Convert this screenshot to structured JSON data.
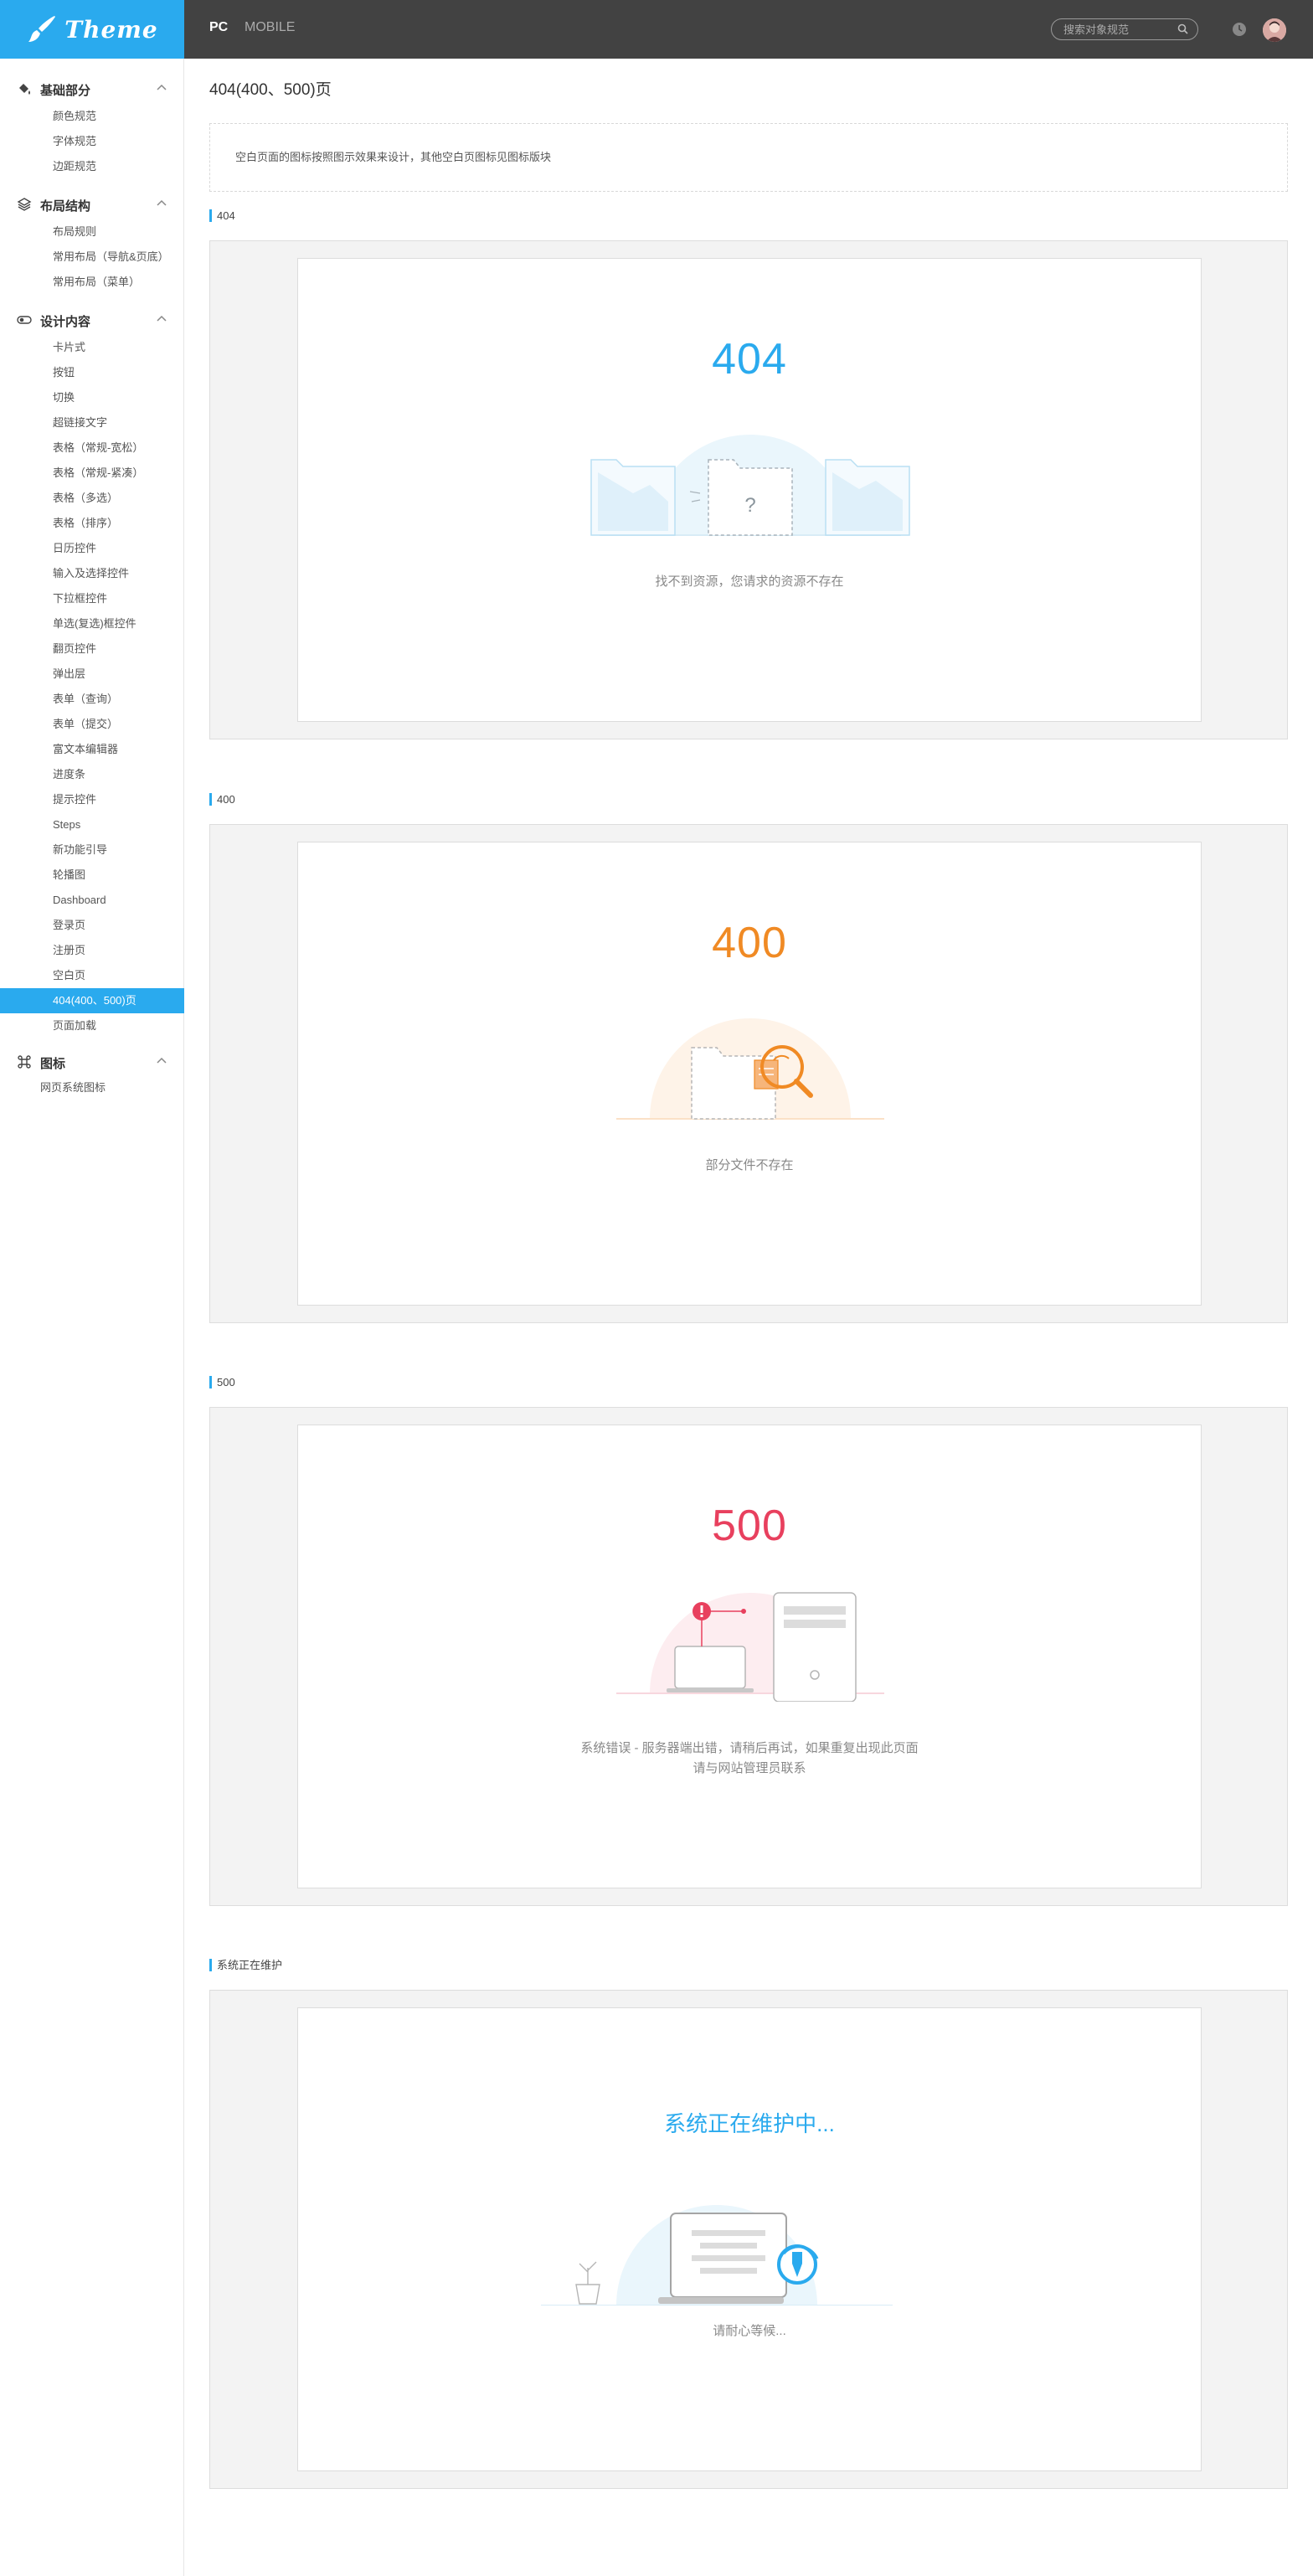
{
  "header": {
    "logo_text": "Theme",
    "tabs": [
      {
        "label": "PC"
      },
      {
        "label": "MOBILE"
      }
    ],
    "search_placeholder": "搜索对象规范",
    "colors": {
      "header_bg": "#424242",
      "logo_bg": "#2aaaee"
    }
  },
  "sidebar": {
    "groups": [
      {
        "title": "基础部分",
        "icon": "paint-bucket-icon",
        "items": [
          "颜色规范",
          "字体规范",
          "边距规范"
        ]
      },
      {
        "title": "布局结构",
        "icon": "layers-icon",
        "items": [
          "布局规则",
          "常用布局（导航&页底）",
          "常用布局（菜单）"
        ]
      },
      {
        "title": "设计内容",
        "icon": "toggle-icon",
        "items": [
          "卡片式",
          "按钮",
          "切换",
          "超链接文字",
          "表格（常规-宽松）",
          "表格（常规-紧凑）",
          "表格（多选）",
          "表格（排序）",
          "日历控件",
          "输入及选择控件",
          "下拉框控件",
          "单选(复选)框控件",
          "翻页控件",
          "弹出层",
          "表单（查询）",
          "表单（提交）",
          "富文本编辑器",
          "进度条",
          "提示控件",
          "Steps",
          "新功能引导",
          "轮播图",
          "Dashboard",
          "登录页",
          "注册页",
          "空白页",
          "404(400、500)页",
          "页面加载"
        ]
      },
      {
        "title": "图标",
        "icon": "command-icon",
        "items": [
          "网页系统图标"
        ]
      }
    ],
    "active_item": "404(400、500)页"
  },
  "main": {
    "title": "404(400、500)页",
    "notice": "空白页面的图标按照图示效果来设计，其他空白页图标见图标版块",
    "sections": [
      {
        "label": "404",
        "code": "404",
        "desc": "找不到资源，您请求的资源不存在",
        "color": "#2aaaee"
      },
      {
        "label": "400",
        "code": "400",
        "desc": "部分文件不存在",
        "color": "#f08a24"
      },
      {
        "label": "500",
        "code": "500",
        "desc_line1": "系统错误 - 服务器端出错，请稍后再试，如果重复出现此页面",
        "desc_line2": "请与网站管理员联系",
        "color": "#e8405e"
      },
      {
        "label": "系统正在维护",
        "code": "系统正在维护中...",
        "desc": "请耐心等候...",
        "color": "#2aaaee"
      }
    ]
  }
}
